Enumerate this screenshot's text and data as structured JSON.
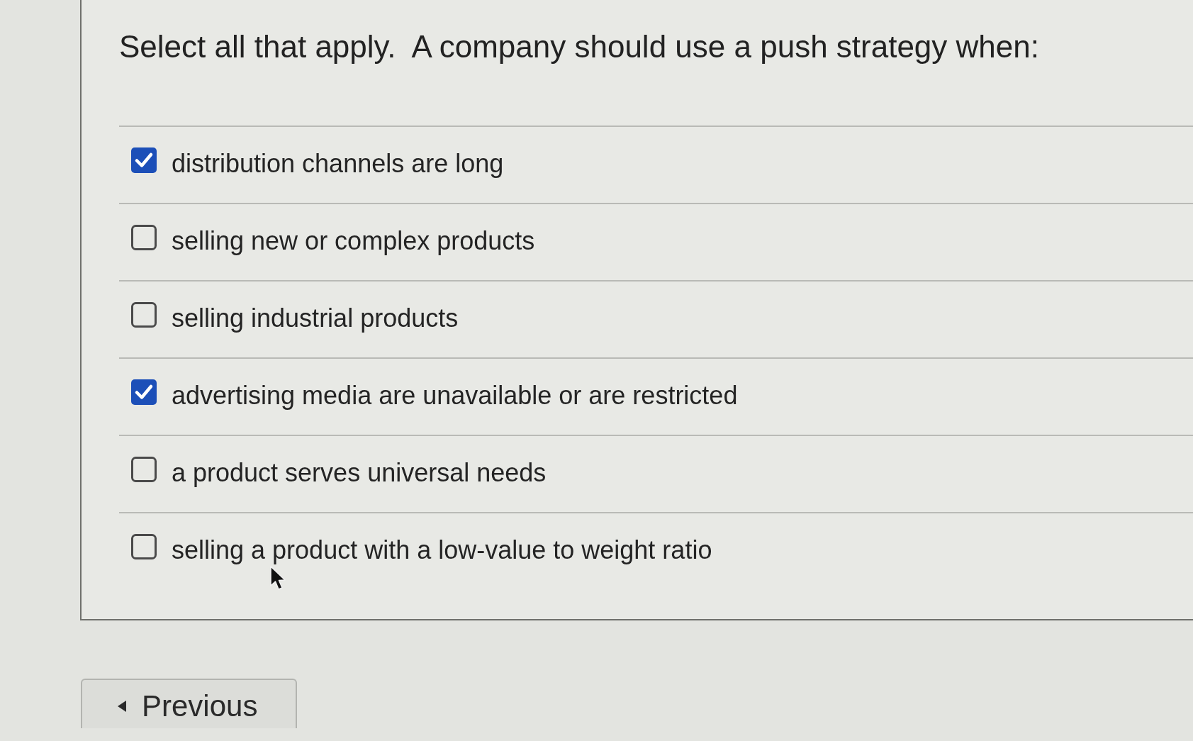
{
  "question": {
    "text": "Select all that apply.  A company should use a push strategy when:"
  },
  "options": [
    {
      "label": "distribution channels are long",
      "checked": true
    },
    {
      "label": "selling new or complex products",
      "checked": false
    },
    {
      "label": "selling industrial products",
      "checked": false
    },
    {
      "label": "advertising media are unavailable or are restricted",
      "checked": true
    },
    {
      "label": "a product serves universal needs",
      "checked": false
    },
    {
      "label": "selling a product with a low-value to weight ratio",
      "checked": false
    }
  ],
  "navigation": {
    "previous_button": "Previous"
  }
}
